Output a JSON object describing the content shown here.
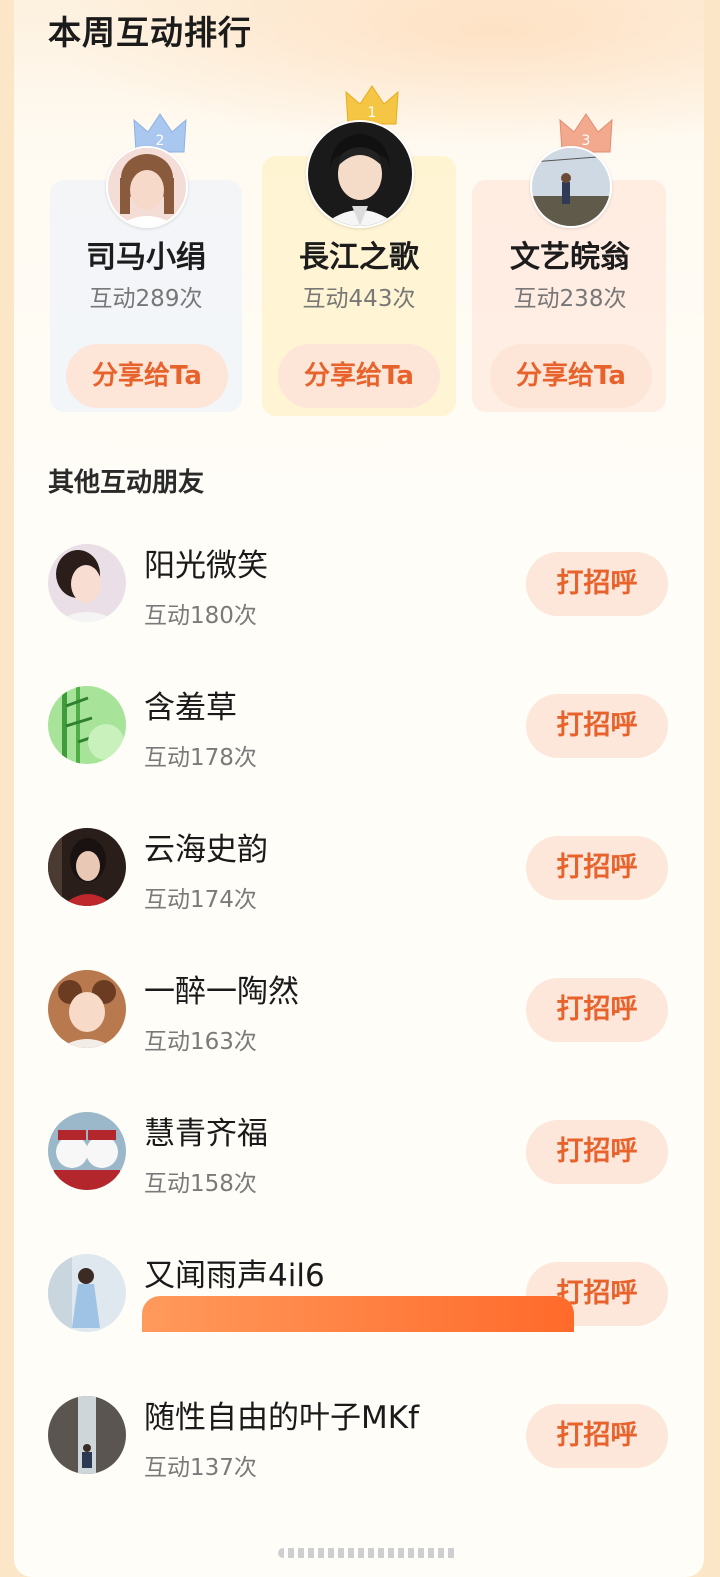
{
  "page": {
    "title": "本周互动排行",
    "others_title": "其他互动朋友"
  },
  "colors": {
    "accent": "#e8622c",
    "button_bg": "#fde7da",
    "gold": "#f5c544",
    "silver": "#a9c7ef",
    "bronze": "#f2a98e"
  },
  "podium": [
    {
      "rank": "2",
      "name": "司马小绢",
      "count": "互动289次",
      "share_label": "分享给Ta",
      "crown": "silver-crown-icon"
    },
    {
      "rank": "1",
      "name": "長江之歌",
      "count": "互动443次",
      "share_label": "分享给Ta",
      "crown": "gold-crown-icon"
    },
    {
      "rank": "3",
      "name": "文艺皖翁",
      "count": "互动238次",
      "share_label": "分享给Ta",
      "crown": "bronze-crown-icon"
    }
  ],
  "others": [
    {
      "name": "阳光微笑",
      "count": "互动180次",
      "button": "打招呼"
    },
    {
      "name": "含羞草",
      "count": "互动178次",
      "button": "打招呼"
    },
    {
      "name": "云海史韵",
      "count": "互动174次",
      "button": "打招呼"
    },
    {
      "name": "一醉一陶然",
      "count": "互动163次",
      "button": "打招呼"
    },
    {
      "name": "慧青齐福",
      "count": "互动158次",
      "button": "打招呼"
    },
    {
      "name": "又闻雨声4il6",
      "count": "",
      "button": "打招呼"
    },
    {
      "name": "随性自由的叶子MKf",
      "count": "互动137次",
      "button": "打招呼"
    }
  ]
}
